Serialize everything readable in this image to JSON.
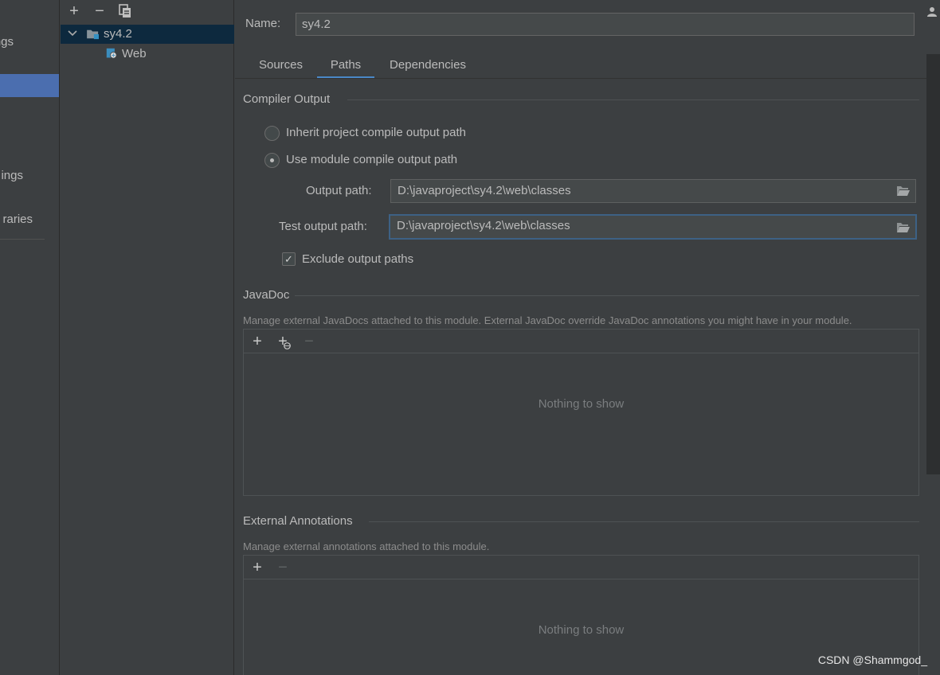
{
  "sidebar": {
    "items": [
      {
        "label": "ngs"
      },
      {
        "label": "ings"
      },
      {
        "label": "raries"
      }
    ]
  },
  "tree": {
    "toolbar": {
      "add": "+",
      "remove": "−"
    },
    "nodes": [
      {
        "label": "sy4.2",
        "selected": true
      },
      {
        "label": "Web",
        "selected": false
      }
    ]
  },
  "module": {
    "name_label": "Name:",
    "name_value": "sy4.2",
    "tabs": [
      {
        "label": "Sources",
        "active": false
      },
      {
        "label": "Paths",
        "active": true
      },
      {
        "label": "Dependencies",
        "active": false
      }
    ]
  },
  "compiler_output": {
    "title": "Compiler Output",
    "inherit_label": "Inherit project compile output path",
    "use_module_label": "Use module compile output path",
    "selected_option": "use_module",
    "output_path_label": "Output path:",
    "output_path_value": "D:\\javaproject\\sy4.2\\web\\classes",
    "test_output_path_label": "Test output path:",
    "test_output_path_value": "D:\\javaproject\\sy4.2\\web\\classes",
    "exclude_label": "Exclude output paths",
    "exclude_checked": true,
    "exclude_check_glyph": "✓"
  },
  "javadoc": {
    "title": "JavaDoc",
    "hint": "Manage external JavaDocs attached to this module. External JavaDoc override JavaDoc annotations you might have in your module.",
    "empty_text": "Nothing to show",
    "toolbar": {
      "add": "+",
      "add_url": "+",
      "remove": "−"
    }
  },
  "external_annotations": {
    "title": "External Annotations",
    "hint": "Manage external annotations attached to this module.",
    "empty_text": "Nothing to show",
    "toolbar": {
      "add": "+",
      "remove": "−"
    }
  },
  "watermark": "CSDN @Shammgod_",
  "colors": {
    "background": "#3c3f41",
    "selection": "#4b6eaf",
    "tree_selection": "#0d293e",
    "tab_underline": "#4a88c7",
    "focus_border": "#3d6185"
  }
}
